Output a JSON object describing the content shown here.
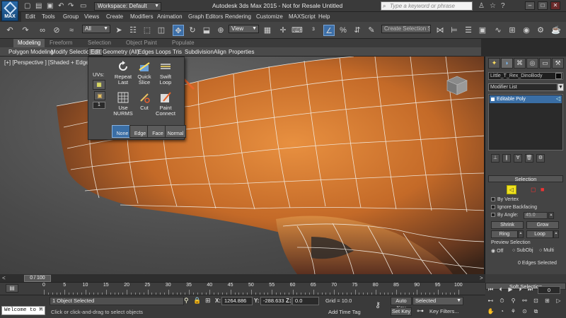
{
  "app": {
    "logo_text": "MAX",
    "workspace": "Workspace: Default",
    "title": "Autodesk 3ds Max 2015   -  Not for Resale   Untitled",
    "search_placeholder": "Type a keyword or phrase"
  },
  "menus": [
    "Edit",
    "Tools",
    "Group",
    "Views",
    "Create",
    "Modifiers",
    "Animation",
    "Graph Editors",
    "Rendering",
    "Customize",
    "MAXScript",
    "Help"
  ],
  "toolbar": {
    "selection_filter": "All",
    "ref_coord": "View",
    "create_selection_set": "Create Selection Se"
  },
  "ribbon": {
    "tabs": [
      "Modeling",
      "Freeform",
      "Selection",
      "Object Paint",
      "Populate"
    ],
    "active_tab": "Modeling",
    "panels": [
      "Polygon Modeling",
      "Modify Selection",
      "Edit",
      "Geometry (All)",
      "Edges",
      "Loops",
      "Tris",
      "Subdivision",
      "Align",
      "Properties"
    ],
    "active_panel": "Edit"
  },
  "viewport": {
    "label": "[+] [Perspective ] [Shaded + Edged Fa"
  },
  "edit_panel": {
    "uvs_label": "UVs:",
    "tools": [
      {
        "line1": "Repeat",
        "line2": "Last"
      },
      {
        "line1": "Quick",
        "line2": "Slice"
      },
      {
        "line1": "Swift",
        "line2": "Loop"
      },
      {
        "line1": "Use",
        "line2": "NURMS"
      },
      {
        "line1": "Cut",
        "line2": ""
      },
      {
        "line1": "Paint",
        "line2": "Connect"
      }
    ],
    "subobject_buttons": [
      "None",
      "Edge",
      "Face",
      "Normal"
    ],
    "active_subobject": "None",
    "uv_channel": "1"
  },
  "command_panel": {
    "object_name": "Little_T_Rex_DinoBody",
    "modifier_list": "Modifier List",
    "stack_item": "Editable Poly",
    "selection_rollout": "Selection",
    "by_vertex": "By Vertex",
    "ignore_backfacing": "Ignore Backfacing",
    "by_angle": "By Angle:",
    "angle_value": "45.0",
    "shrink": "Shrink",
    "grow": "Grow",
    "ring": "Ring",
    "loop": "Loop",
    "preview_selection": "Preview Selection",
    "preview_options": [
      "Off",
      "SubObj",
      "Multi"
    ],
    "preview_selected": "Off",
    "selected_count": "0 Edges Selected",
    "soft_selection": "Soft Selection"
  },
  "timeline": {
    "frame_counter": "0 / 100",
    "ticks": [
      "0",
      "5",
      "10",
      "15",
      "20",
      "25",
      "30",
      "35",
      "40",
      "45",
      "50",
      "55",
      "60",
      "65",
      "70",
      "75",
      "80",
      "85",
      "90",
      "95",
      "100"
    ]
  },
  "status": {
    "maxscript": "Welcome to M",
    "objects_selected": "1 Object Selected",
    "prompt": "Click or click-and-drag to select objects",
    "x_label": "X:",
    "x_value": "1264.886",
    "y_label": "Y:",
    "y_value": "-288.633",
    "z_label": "Z:",
    "z_value": "0.0",
    "grid": "Grid = 10.0",
    "add_time_tag": "Add Time Tag",
    "auto_key": "Auto Key",
    "set_key": "Set Key",
    "key_mode": "Selected",
    "key_filters": "Key Filters...",
    "current_frame": "0"
  },
  "colors": {
    "accent_blue": "#3a6ea5",
    "highlight_yellow": "#f0e020",
    "arrow_orange": "#e8632a",
    "mesh_orange": "#d8762a"
  }
}
